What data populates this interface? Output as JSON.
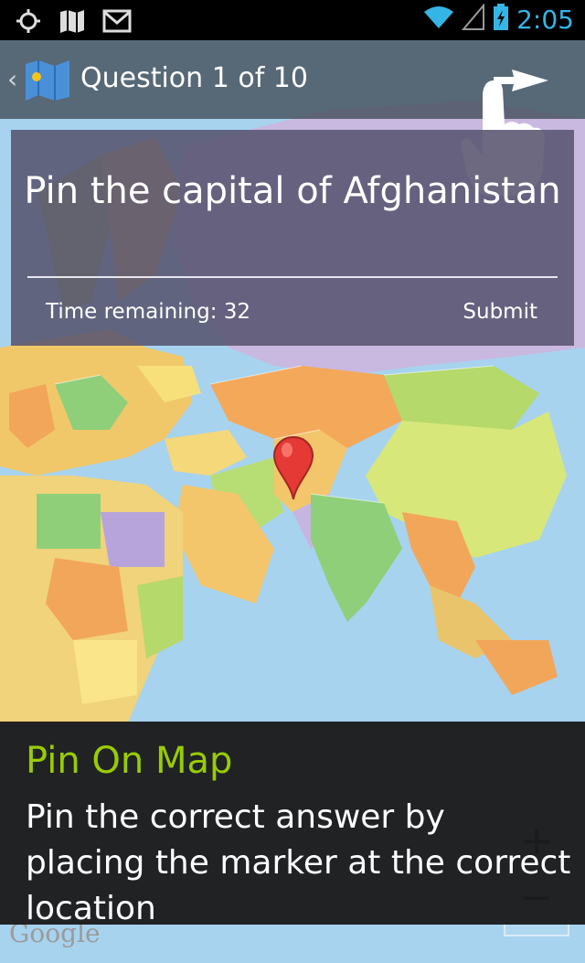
{
  "status_bar": {
    "time": "2:05",
    "left_icons": [
      "gps-icon",
      "maps-icon",
      "gmail-icon"
    ],
    "right_icons": [
      "wifi-icon",
      "signal-icon",
      "battery-charging-icon"
    ]
  },
  "action_bar": {
    "title": "Question 1 of 10",
    "back_icon": "chevron-left-icon",
    "app_icon": "map-icon"
  },
  "question": {
    "prompt": "Pin the capital of Afghanistan",
    "time_remaining": "Time remaining: 32",
    "submit_label": "Submit"
  },
  "map": {
    "attribution": "Google",
    "zoom_in": "+",
    "zoom_out": "−"
  },
  "tutorial": {
    "title": "Pin On Map",
    "description": "Pin the correct answer by placing the marker at the correct location"
  },
  "colors": {
    "accent": "#35b5e5",
    "tutorial_title": "#99cc00",
    "ocean": "#a7d3ef"
  }
}
